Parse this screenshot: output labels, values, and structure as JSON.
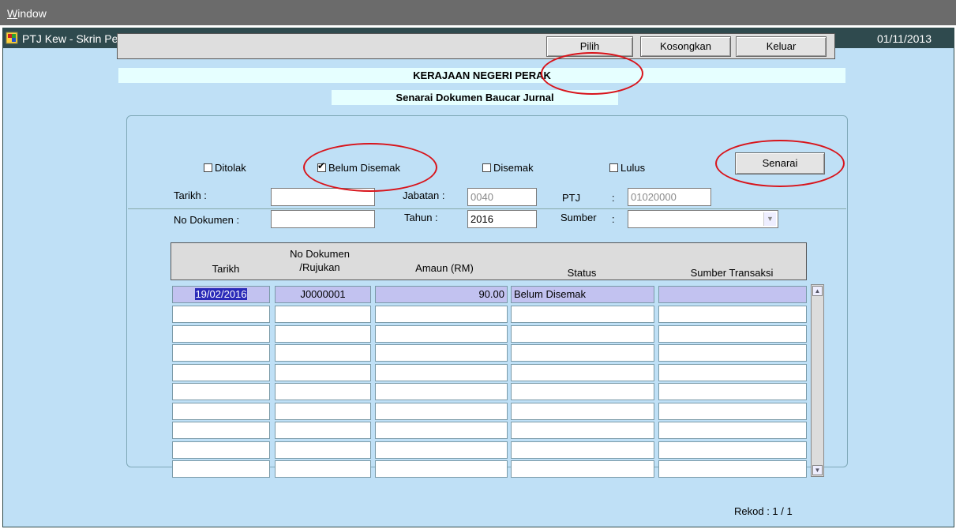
{
  "menubar": {
    "window_prefix": "W",
    "window_rest": "indow"
  },
  "window": {
    "title": "PTJ Kew - Skrin Pertanyaan Baucer Jurnal",
    "date": "01/11/2013",
    "app_icon": "oracle-forms-icon"
  },
  "toolbar": {
    "pilih": "Pilih",
    "kosongkan": "Kosongkan",
    "keluar": "Keluar"
  },
  "banners": {
    "state": "KERAJAAN NEGERI PERAK",
    "list": "Senarai Dokumen Baucar Jurnal"
  },
  "filters": {
    "checkboxes": [
      {
        "label": "Ditolak",
        "checked": false
      },
      {
        "label": "Belum Disemak",
        "checked": true
      },
      {
        "label": "Disemak",
        "checked": false
      },
      {
        "label": "Lulus",
        "checked": false
      }
    ],
    "senarai": "Senarai",
    "tarikh_label": "Tarikh :",
    "tarikh_value": "",
    "no_dokumen_label": "No Dokumen :",
    "no_dokumen_value": "",
    "jabatan_label": "Jabatan :",
    "jabatan_value": "0040",
    "tahun_label": "Tahun :",
    "tahun_value": "2016",
    "ptj_label": "PTJ",
    "ptj_colon": ":",
    "ptj_value": "01020000",
    "sumber_label": "Sumber",
    "sumber_colon": ":",
    "sumber_value": ""
  },
  "table": {
    "headers": {
      "tarikh": "Tarikh",
      "no_dok_line1": "No Dokumen",
      "no_dok_line2": "/Rujukan",
      "amaun": "Amaun (RM)",
      "status": "Status",
      "sumber": "Sumber Transaksi"
    },
    "rows": [
      {
        "tarikh": "19/02/2016",
        "no_dokumen": "J0000001",
        "amaun": "90.00",
        "status": "Belum Disemak",
        "sumber": ""
      }
    ],
    "empty_rows": 9
  },
  "status": {
    "rekod": "Rekod : 1 / 1"
  },
  "colors": {
    "background": "#bfe0f6",
    "titlebar": "#2f4a4e",
    "highlight": "#2a2ab8",
    "selected_row": "#c2c2f0",
    "annotation": "#d8141b"
  }
}
